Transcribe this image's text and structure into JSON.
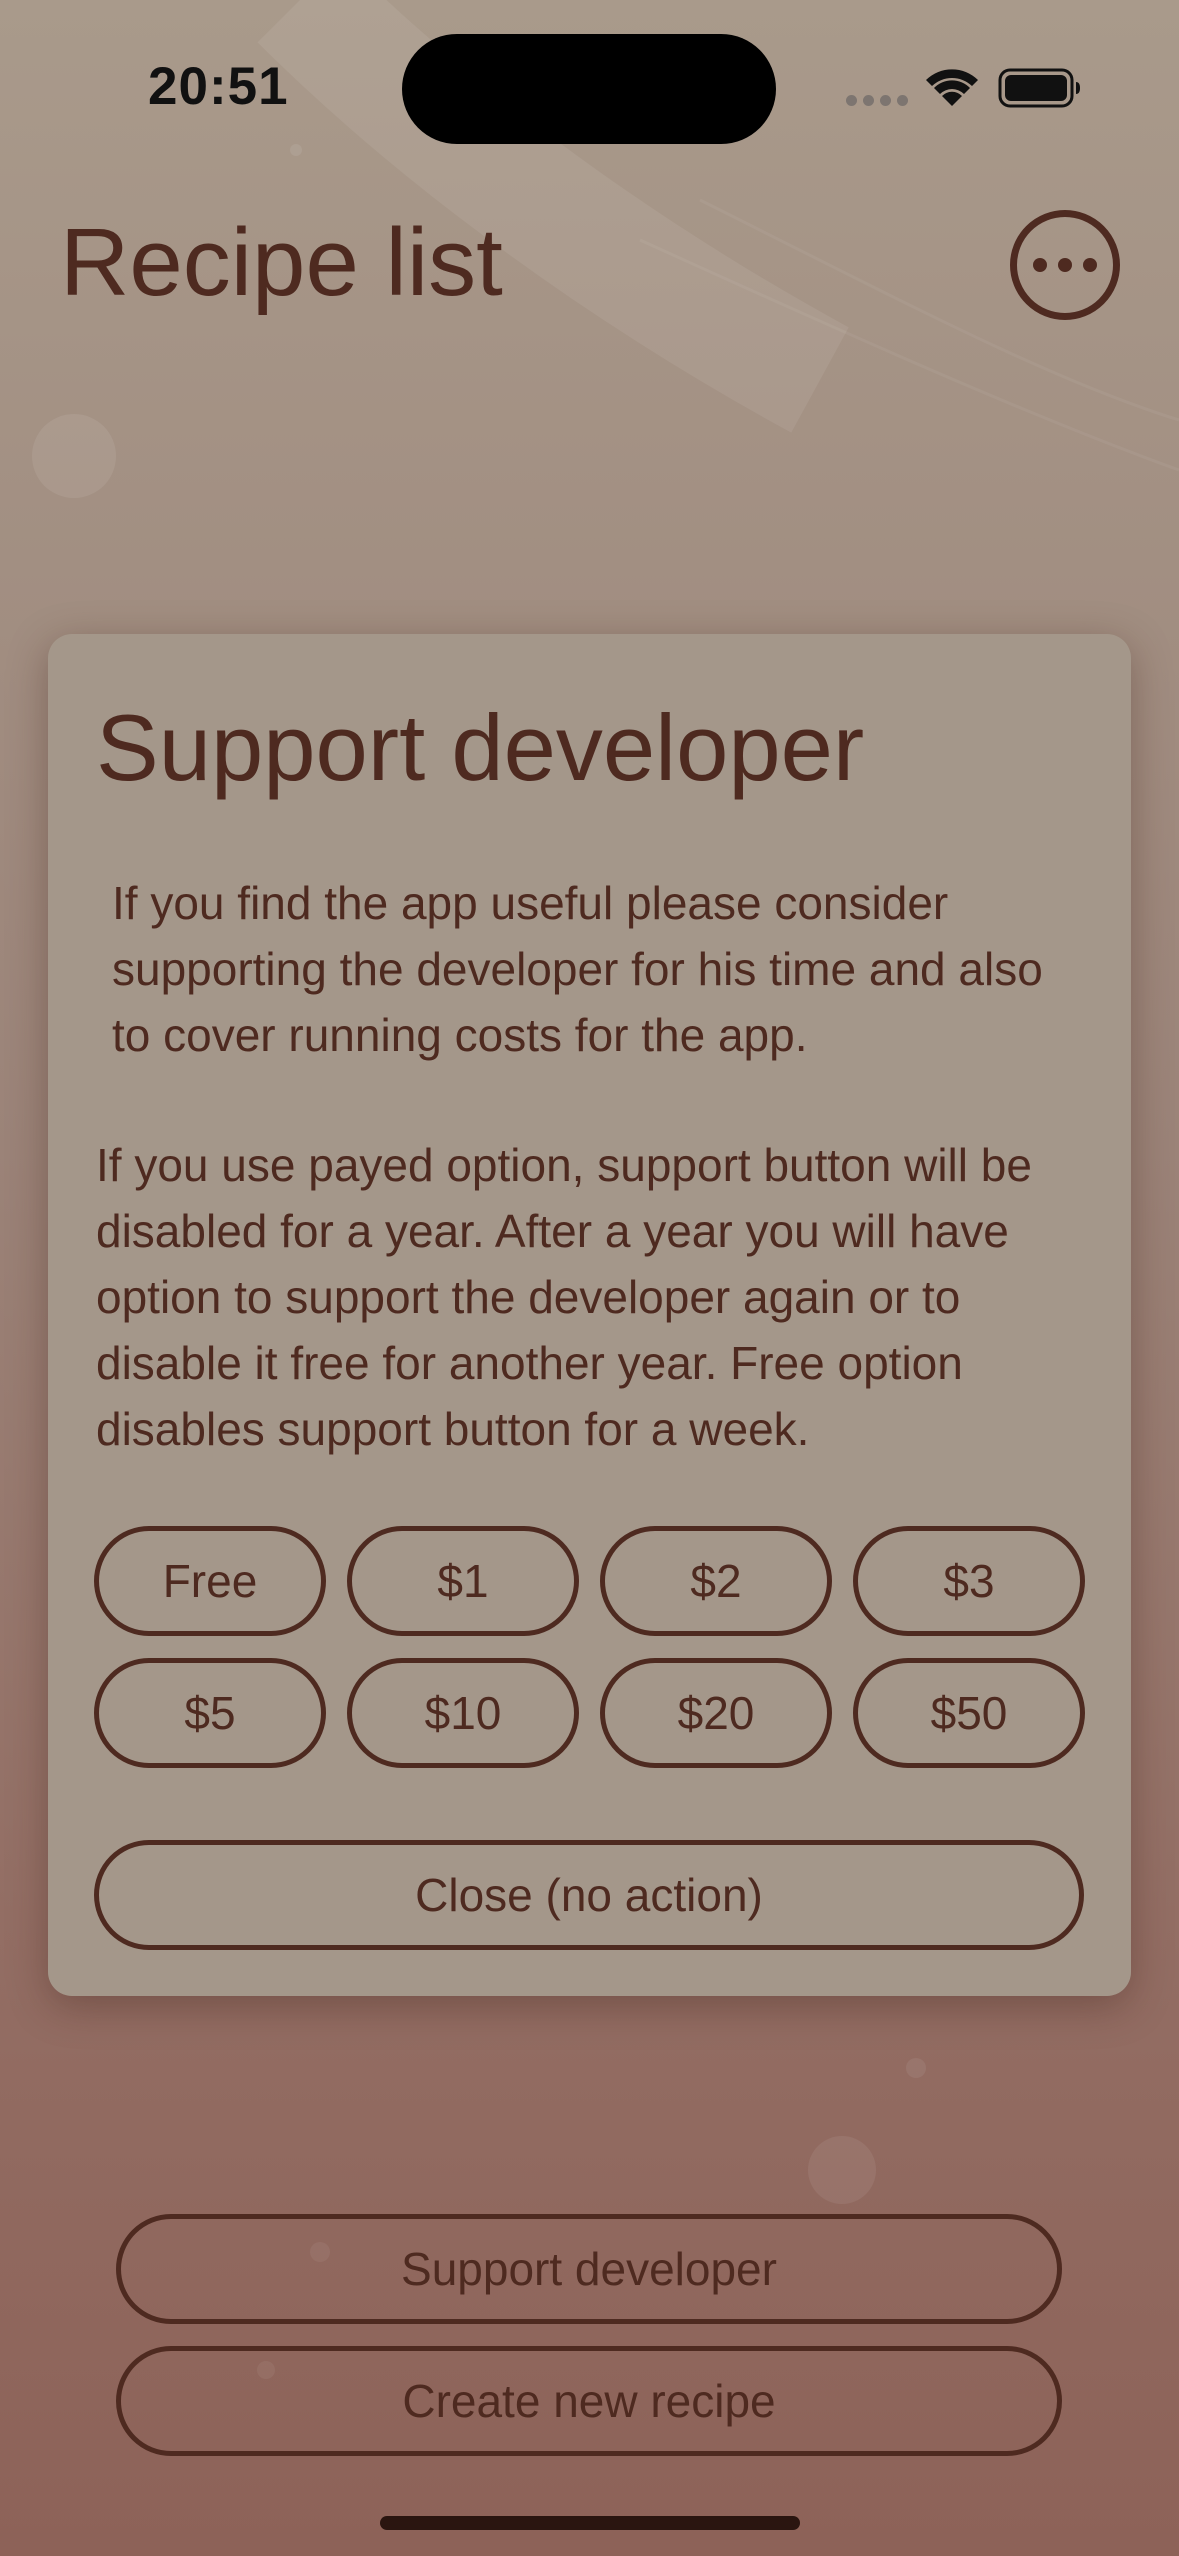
{
  "status_bar": {
    "time": "20:51"
  },
  "header": {
    "title": "Recipe list",
    "more_icon": "ellipsis-circle-icon"
  },
  "modal": {
    "title": "Support developer",
    "paragraph_1": "If you find the app useful please consider supporting the developer for his time and also to cover running costs for the app.",
    "paragraph_2": "If you use payed option, support button will be disabled for a year. After a year you will have option to support the developer again or to disable it free for another year. Free option disables support button for a week.",
    "amounts": [
      "Free",
      "$1",
      "$2",
      "$3",
      "$5",
      "$10",
      "$20",
      "$50"
    ],
    "close_label": "Close (no action)"
  },
  "bottom": {
    "support_label": "Support developer",
    "create_label": "Create new recipe"
  },
  "colors": {
    "accent": "#4e2a20",
    "modal_bg": "#a4978a",
    "bg_top": "#a99a8b",
    "bg_bottom": "#8d6258"
  }
}
